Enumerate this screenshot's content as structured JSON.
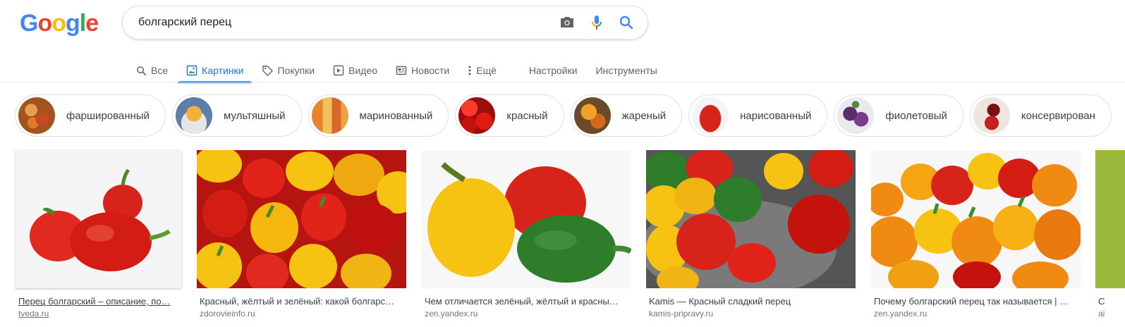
{
  "logo": {
    "letters": [
      "G",
      "o",
      "o",
      "g",
      "l",
      "e"
    ],
    "colors": [
      "#4285f4",
      "#ea4335",
      "#fbbc05",
      "#4285f4",
      "#34a853",
      "#ea4335"
    ]
  },
  "search": {
    "query": "болгарский перец",
    "icons": [
      "camera-icon",
      "mic-icon",
      "search-icon"
    ]
  },
  "tabs": [
    {
      "label": "Все",
      "icon": "search-icon",
      "active": false
    },
    {
      "label": "Картинки",
      "icon": "image-icon",
      "active": true
    },
    {
      "label": "Покупки",
      "icon": "tag-icon",
      "active": false
    },
    {
      "label": "Видео",
      "icon": "play-icon",
      "active": false
    },
    {
      "label": "Новости",
      "icon": "news-icon",
      "active": false
    },
    {
      "label": "Ещё",
      "icon": "more-vert-icon",
      "active": false
    },
    {
      "label": "Настройки"
    },
    {
      "label": "Инструменты"
    }
  ],
  "chips": [
    {
      "label": "фаршированный"
    },
    {
      "label": "мультяшный"
    },
    {
      "label": "маринованный"
    },
    {
      "label": "красный"
    },
    {
      "label": "жареный"
    },
    {
      "label": "нарисованный"
    },
    {
      "label": "фиолетовый"
    },
    {
      "label": "консервирован"
    }
  ],
  "results": [
    {
      "title": "Перец болгарский – описание, по…",
      "source": "tveda.ru"
    },
    {
      "title": "Красный, жёлтый и зелёный: какой болгарс…",
      "source": "zdorovieinfo.ru"
    },
    {
      "title": "Чем отличается зелёный, жёлтый и красны…",
      "source": "zen.yandex.ru"
    },
    {
      "title": "Kamis — Красный сладкий перец",
      "source": "kamis-pripravy.ru"
    },
    {
      "title": "Почему болгарский перец так называется | …",
      "source": "zen.yandex.ru"
    },
    {
      "title": "С",
      "source": "ai"
    }
  ],
  "colors": {
    "accent": "#1a73e8",
    "pepper_red": "#d8231b",
    "pepper_yellow": "#f7c313",
    "pepper_orange": "#f08a12",
    "pepper_green": "#2e7d2a"
  }
}
